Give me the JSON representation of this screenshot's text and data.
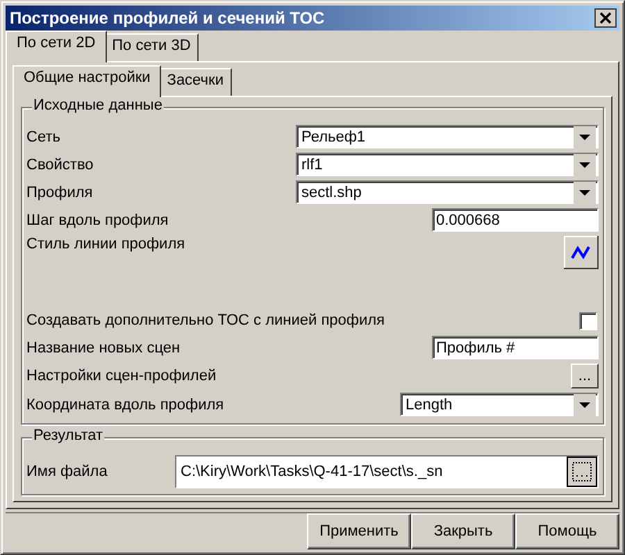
{
  "window": {
    "title": "Построение профилей и сечений ТОС"
  },
  "tabs": [
    {
      "label": "По сети 2D",
      "selected": true
    },
    {
      "label": "По сети 3D",
      "selected": false
    }
  ],
  "subtabs": [
    {
      "label": "Общие настройки",
      "selected": true
    },
    {
      "label": "Засечки",
      "selected": false
    }
  ],
  "source_group": {
    "title": "Исходные данные",
    "rows": [
      {
        "kind": "combo",
        "label": "Сеть",
        "value": "Рельеф1"
      },
      {
        "kind": "combo",
        "label": "Свойство",
        "value": "rlf1"
      },
      {
        "kind": "combo",
        "label": "Профиля",
        "value": "sectl.shp"
      },
      {
        "kind": "text",
        "label": "Шаг вдоль профиля",
        "value": "0.000668"
      },
      {
        "kind": "style",
        "label": "Стиль линии профиля"
      },
      {
        "kind": "checkbox",
        "label": "Создавать дополнительно ТОС с линией профиля",
        "checked": false
      },
      {
        "kind": "text",
        "label": "Название новых сцен",
        "value": "Профиль #"
      },
      {
        "kind": "button",
        "label": "Настройки сцен-профилей",
        "button": "..."
      },
      {
        "kind": "combo",
        "label": "Координата вдоль профиля",
        "value": "Length"
      }
    ]
  },
  "result_group": {
    "title": "Результат",
    "label": "Имя файла",
    "value": "C:\\Kiry\\Work\\Tasks\\Q-41-17\\sect\\s._sn"
  },
  "buttons": [
    "Применить",
    "Закрыть",
    "Помощь"
  ]
}
